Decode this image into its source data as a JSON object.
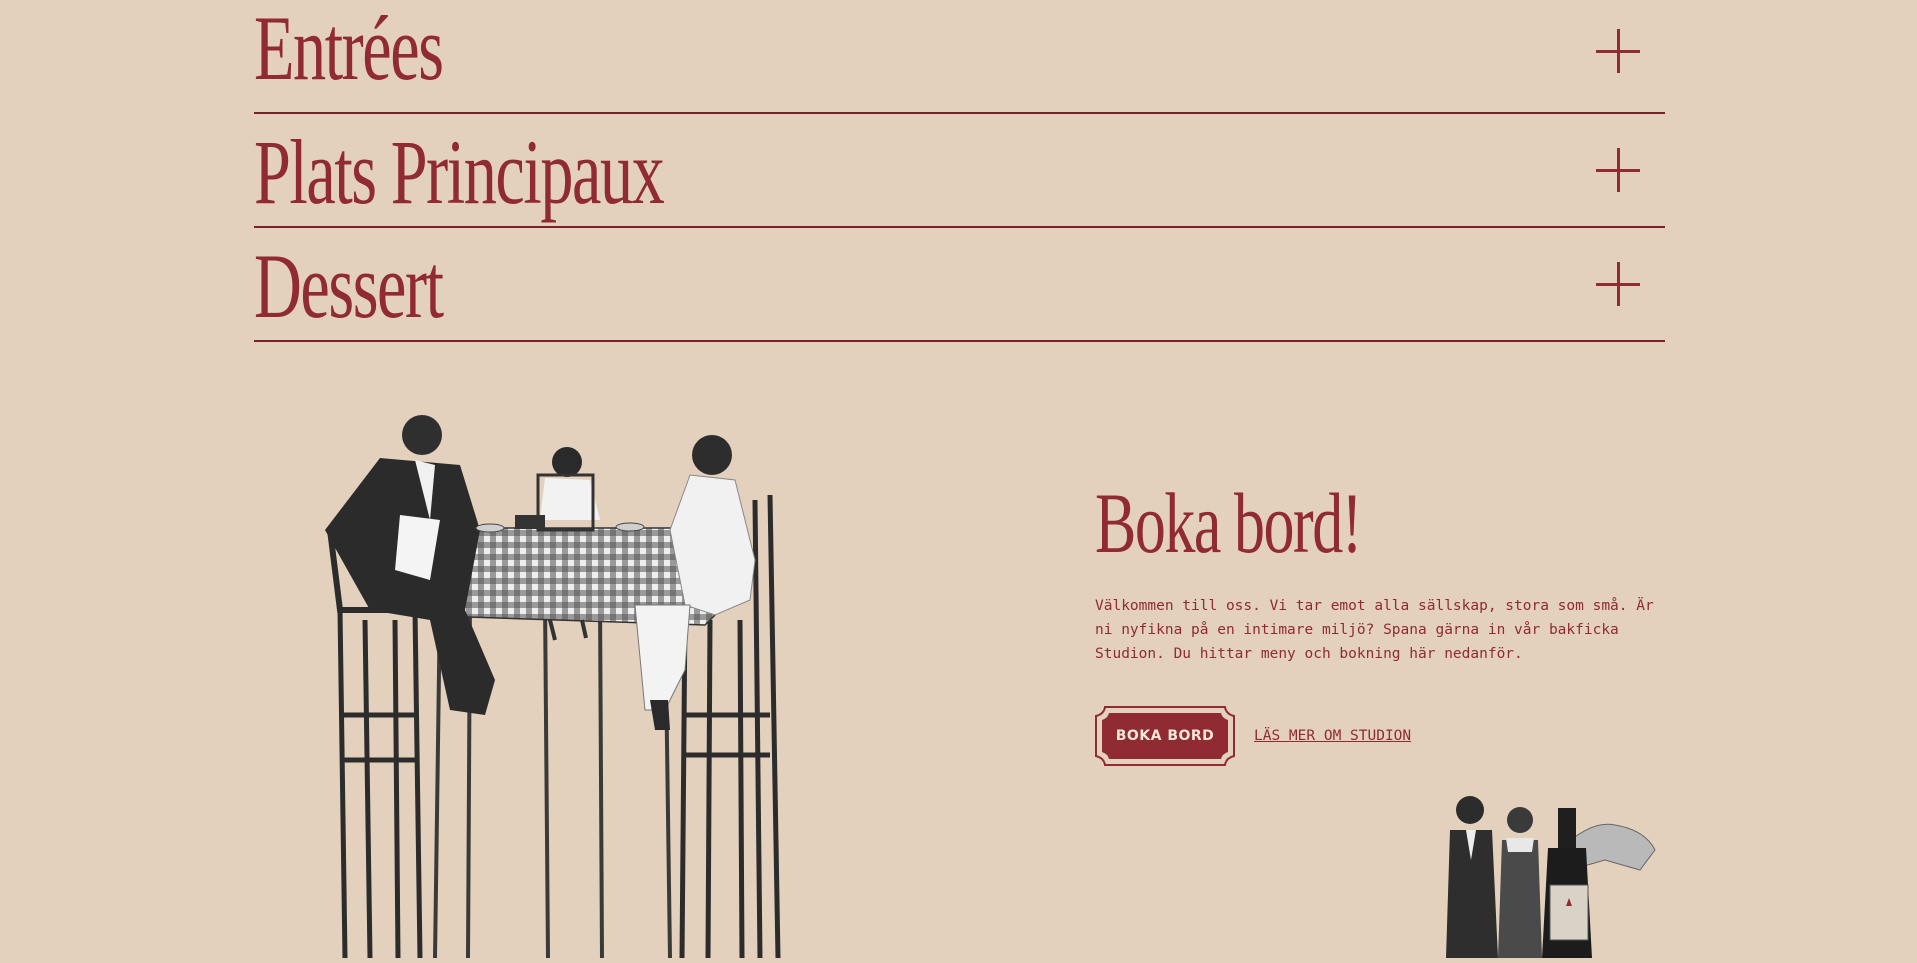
{
  "menu": {
    "sections": [
      {
        "title": "Entrées"
      },
      {
        "title": "Plats Principaux"
      },
      {
        "title": "Dessert"
      }
    ]
  },
  "booking": {
    "heading": "Boka bord!",
    "description": "Välkommen till oss. Vi tar emot alla sällskap, stora som små. Är ni nyfikna på en intimare miljö? Spana gärna in vår bakficka Studion. Du hittar meny och bokning här nedanför.",
    "primary_button": "BOKA BORD",
    "secondary_link": "LÄS MER OM STUDION"
  },
  "colors": {
    "background": "#e4d1bd",
    "accent": "#8f2b31",
    "button_text": "#f3e6d6"
  }
}
